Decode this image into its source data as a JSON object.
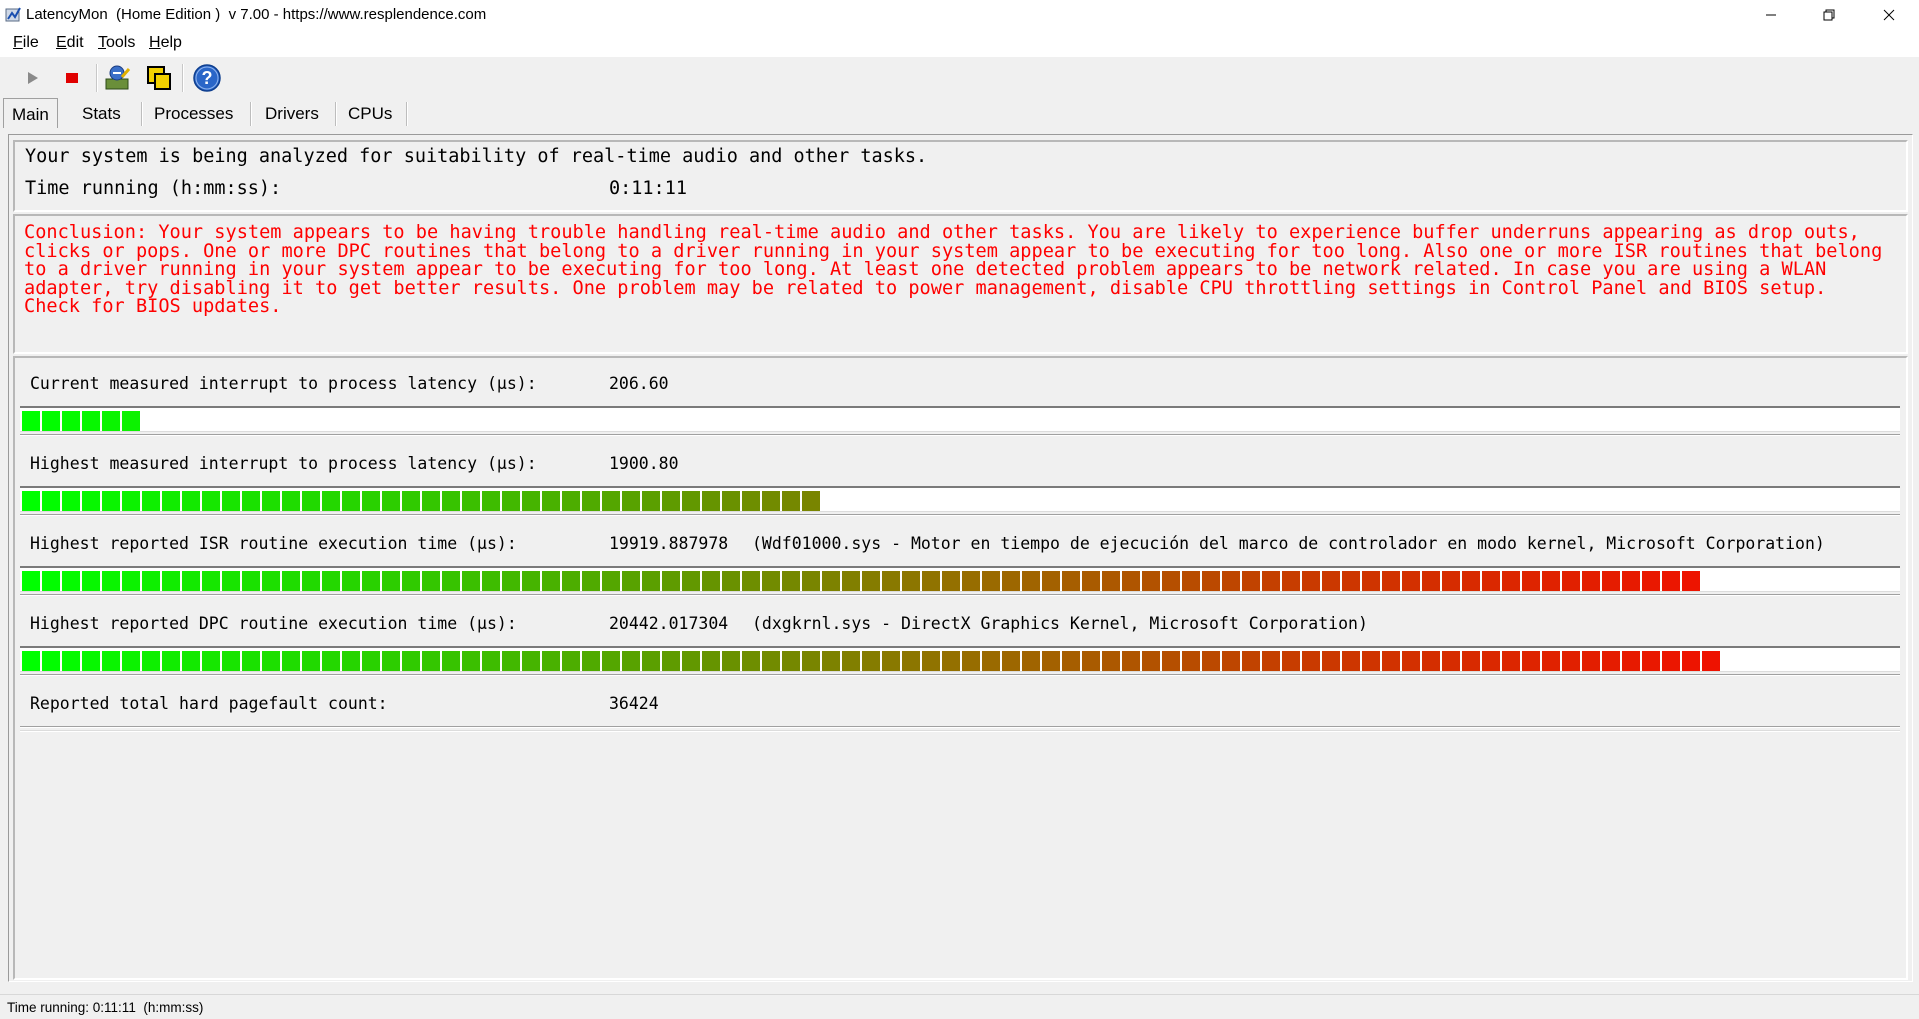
{
  "window": {
    "title": "LatencyMon  (Home Edition )  v 7.00 - https://www.resplendence.com",
    "app_icon": "latencymon-icon",
    "controls": [
      "minimize-icon",
      "restore-icon",
      "close-icon"
    ]
  },
  "menu": [
    "File",
    "Edit",
    "Tools",
    "Help"
  ],
  "toolbar": [
    {
      "name": "start-icon",
      "color": "#7a7a7a"
    },
    {
      "name": "stop-icon",
      "color": "#e00000"
    },
    {
      "name": "analyze-icon"
    },
    {
      "name": "windows-icon"
    },
    {
      "name": "help-icon",
      "color": "#2a66c8"
    }
  ],
  "tabs": [
    "Main",
    "Stats",
    "Processes",
    "Drivers",
    "CPUs"
  ],
  "active_tab": "Main",
  "status": {
    "line": "Your system is being analyzed for suitability of real-time audio and other tasks.",
    "time_label": "Time running (h:mm:ss):",
    "time_value": "0:11:11"
  },
  "conclusion": "Conclusion: Your system appears to be having trouble handling real-time audio and other tasks. You are likely to experience buffer underruns appearing as drop outs,\nclicks or pops. One or more DPC routines that belong to a driver running in your system appear to be executing for too long. Also one or more ISR routines that belong\nto a driver running in your system appear to be executing for too long. At least one detected problem appears to be network related. In case you are using a WLAN\nadapter, try disabling it to get better results. One problem may be related to power management, disable CPU throttling settings in Control Panel and BIOS setup.\nCheck for BIOS updates.",
  "conclusion_color": "#ff0000",
  "metrics": [
    {
      "label": "Current measured interrupt to process latency (µs):",
      "value": "206.60",
      "extra": "",
      "level": 0.063
    },
    {
      "label": "Highest measured interrupt to process latency (µs):",
      "value": "1900.80",
      "extra": "",
      "level": 0.427
    },
    {
      "label": "Highest reported ISR routine execution time (µs):",
      "value": "19919.887978",
      "extra": "(Wdf01000.sys - Motor en tiempo de ejecución del marco de controlador en modo kernel, Microsoft Corporation)",
      "level": 0.906
    },
    {
      "label": "Highest reported DPC routine execution time (µs):",
      "value": "20442.017304",
      "extra": "(dxgkrnl.sys - DirectX Graphics Kernel, Microsoft Corporation)",
      "level": 0.916
    },
    {
      "label": "Reported total hard pagefault count:",
      "value": "36424",
      "extra": "",
      "level": null
    }
  ],
  "statusbar": "Time running: 0:11:11  (h:mm:ss)"
}
